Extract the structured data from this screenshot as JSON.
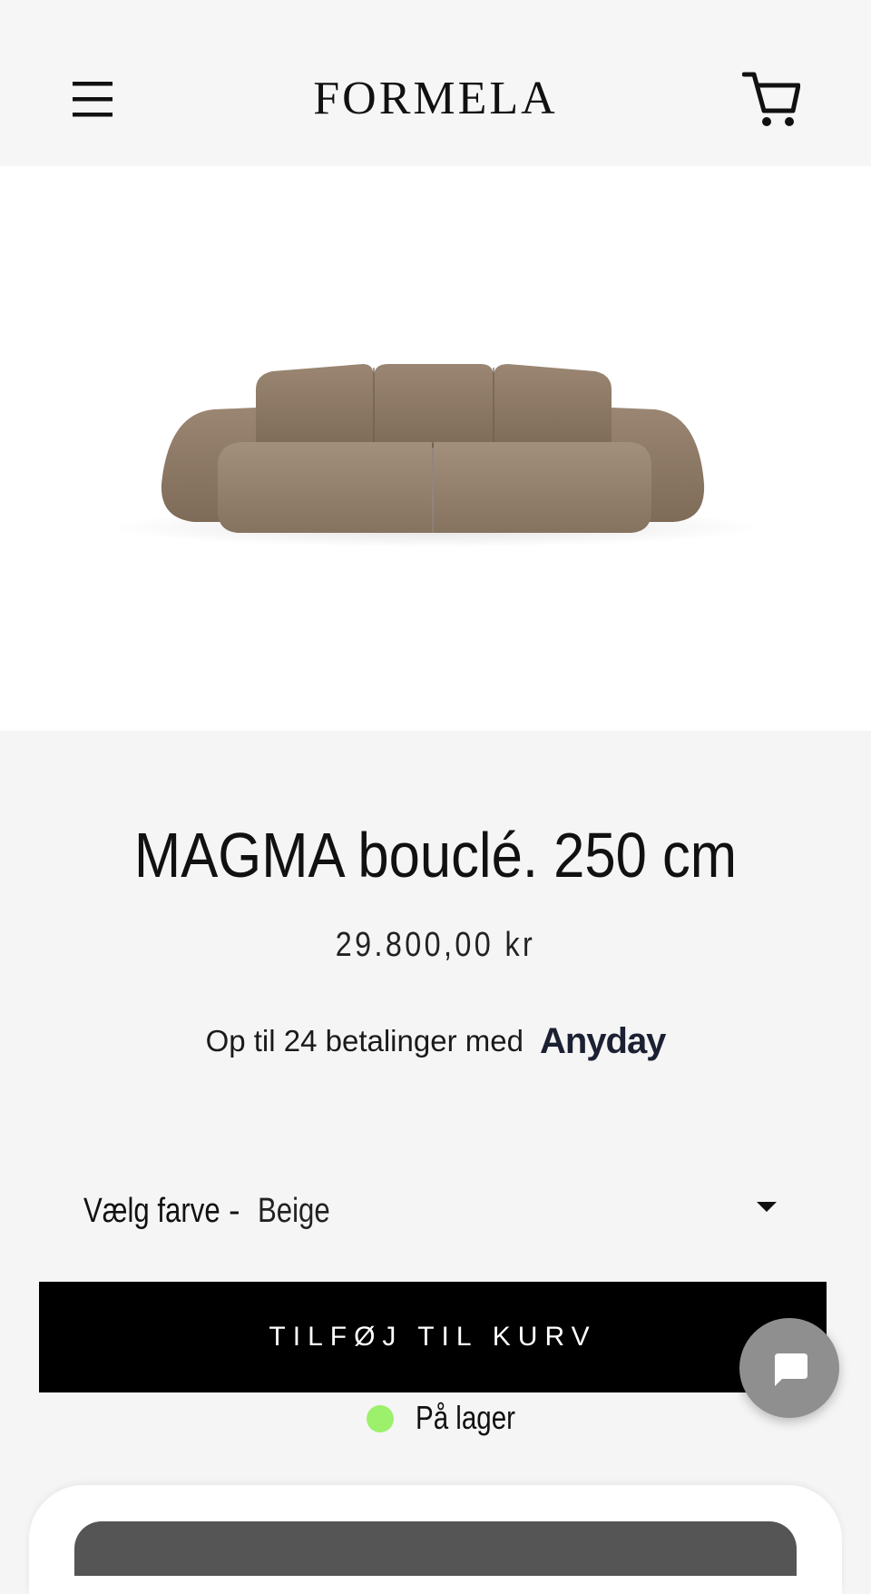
{
  "header": {
    "logo": "FORMELA",
    "menu_icon": "hamburger-menu-icon",
    "cart_icon": "shopping-cart-icon"
  },
  "product": {
    "title": "MAGMA bouclé. 250 cm",
    "price": "29.800,00 kr",
    "image_alt": "sofa-image",
    "color": "#8f7c69"
  },
  "financing": {
    "text": "Op til 24 betalinger med",
    "brand": "Anyday"
  },
  "variant": {
    "label": "Vælg farve",
    "separator": "-",
    "selected": "Beige"
  },
  "actions": {
    "add_to_cart": "TILFØJ TIL KURV"
  },
  "stock": {
    "text": "På lager",
    "color": "#9cf06b"
  },
  "chat": {
    "icon": "chat-bubble-icon"
  }
}
